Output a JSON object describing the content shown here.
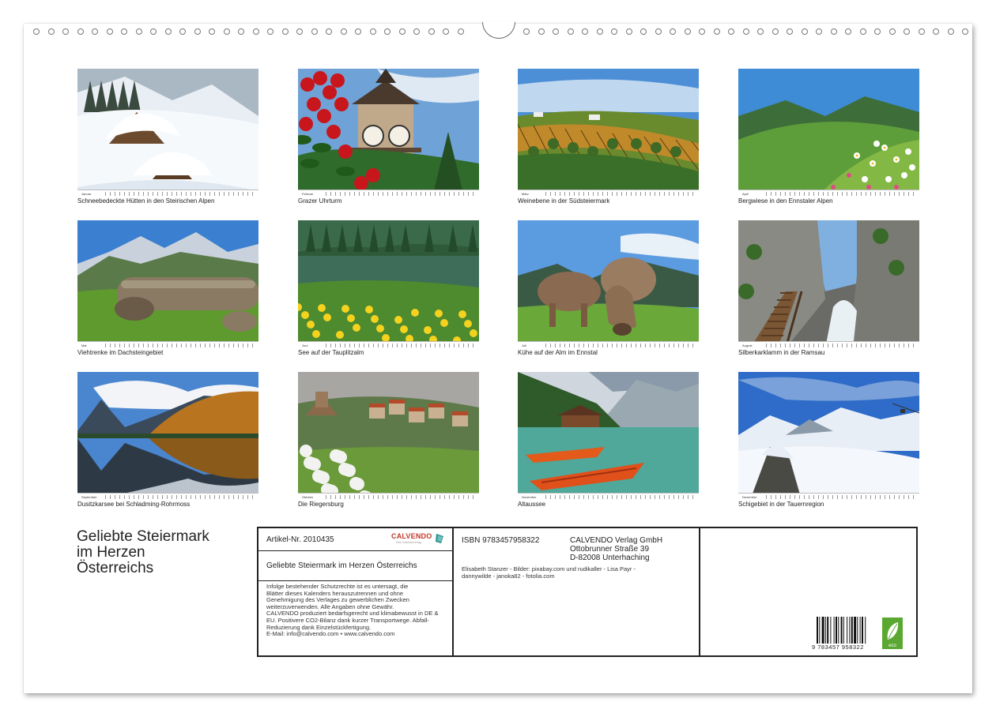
{
  "months": [
    {
      "strip": "Januar",
      "caption": "Schneebedeckte Hütten in den Steirischen Alpen",
      "scene": "snow-huts"
    },
    {
      "strip": "Februar",
      "caption": "Grazer Uhrturm",
      "scene": "clock-tower"
    },
    {
      "strip": "März",
      "caption": "Weinebene in der Südsteiermark",
      "scene": "vineyard"
    },
    {
      "strip": "April",
      "caption": "Bergwiese in den Ennstaler Alpen",
      "scene": "meadow"
    },
    {
      "strip": "Mai",
      "caption": "Viehtrenke im Dachsteingebiet",
      "scene": "trough"
    },
    {
      "strip": "Juni",
      "caption": "See auf der Tauplitzalm",
      "scene": "lake-flowers"
    },
    {
      "strip": "Juli",
      "caption": "Kühe auf der Alm im Ennstal",
      "scene": "cows"
    },
    {
      "strip": "August",
      "caption": "Silberkarklamm in der Ramsau",
      "scene": "gorge"
    },
    {
      "strip": "September",
      "caption": "Dusitzkarsee bei Schladming-Rohrmoss",
      "scene": "reflection"
    },
    {
      "strip": "Oktober",
      "caption": "Die Riegersburg",
      "scene": "castle"
    },
    {
      "strip": "November",
      "caption": "Altaussee",
      "scene": "boats"
    },
    {
      "strip": "Dezember",
      "caption": "Schigebiet in der Tauernregion",
      "scene": "ski"
    }
  ],
  "title": {
    "line1": "Geliebte Steiermark",
    "line2": "im Herzen",
    "line3": "Österreichs"
  },
  "info": {
    "article": "Artikel-Nr. 2010435",
    "brand": "CALVENDO",
    "brand_sub": "Dein Kalenderverlag",
    "product_title": "Geliebte Steiermark im Herzen Österreichs",
    "legal_lines": [
      "Infolge bestehender Schutzrechte ist es untersagt, die",
      "Blätter dieses Kalenders herauszutrennen und ohne",
      "Genehmigung des Verlages zu gewerblichen Zwecken",
      "weiterzuverwenden. Alle Angaben ohne Gewähr.",
      "CALVENDO produziert bedarfsgerecht und klimabewusst in DE &",
      "EU. Positivere CO2-Bilanz dank kurzer Transportwege. Abfall-",
      "Reduzierung dank Einzelstückfertigung.",
      "E-Mail: info@calvendo.com • www.calvendo.com"
    ],
    "isbn": "ISBN 9783457958322",
    "publisher": "CALVENDO Verlag GmbH",
    "street": "Ottobrunner Straße 39",
    "city": "D-82008 Unterhaching",
    "credits_line1": "Elisabeth Stanzer - Bilder: pixabay.com und rudikaller - Lisa Payr -",
    "credits_line2": "dannywilde - janoka82 - fotolia.com",
    "barcode_number": "9 783457 958322",
    "eco_label": "eco"
  },
  "colors": {
    "accent": "#c0392b",
    "eco_green": "#5aa832"
  }
}
